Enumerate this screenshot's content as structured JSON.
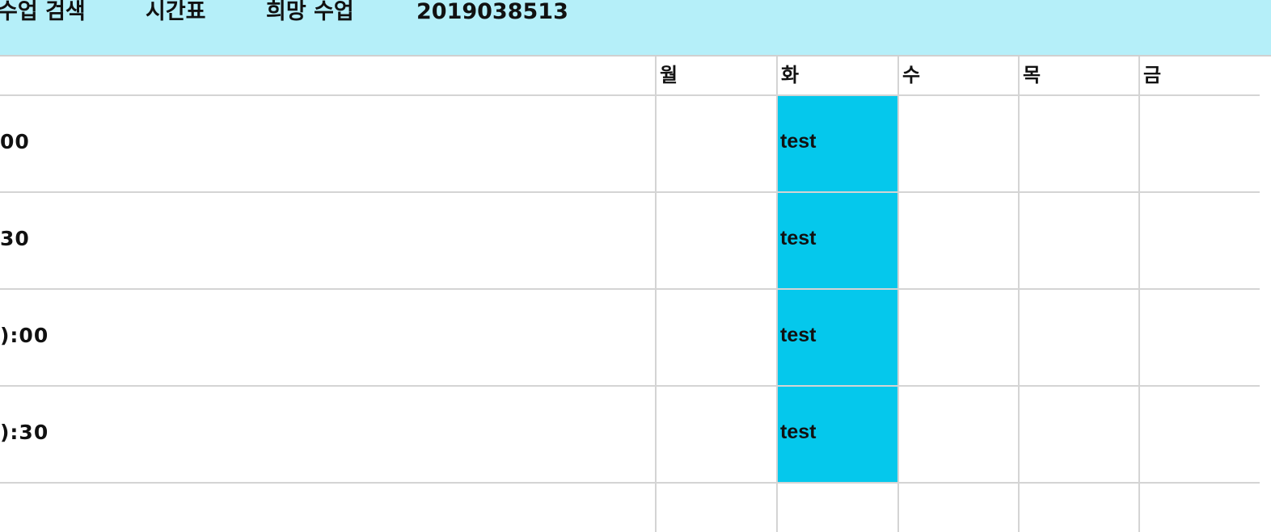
{
  "nav": {
    "search_label": "수업 검색",
    "timetable_label": "시간표",
    "wishlist_label": "희망 수업",
    "student_id": "2019038513"
  },
  "days": [
    "월",
    "화",
    "수",
    "목",
    "금"
  ],
  "slots": [
    {
      "time": "00",
      "mon": "",
      "tue": "test",
      "wed": "",
      "thu": "",
      "fri": ""
    },
    {
      "time": "30",
      "mon": "",
      "tue": "test",
      "wed": "",
      "thu": "",
      "fri": ""
    },
    {
      "time": "):00",
      "mon": "",
      "tue": "test",
      "wed": "",
      "thu": "",
      "fri": ""
    },
    {
      "time": "):30",
      "mon": "",
      "tue": "test",
      "wed": "",
      "thu": "",
      "fri": ""
    },
    {
      "time": "",
      "mon": "",
      "tue": "",
      "wed": "",
      "thu": "",
      "fri": ""
    }
  ],
  "colors": {
    "header_bg": "#b5eff9",
    "filled_slot": "#05c8ec",
    "grid_line": "#d4d4d4"
  }
}
